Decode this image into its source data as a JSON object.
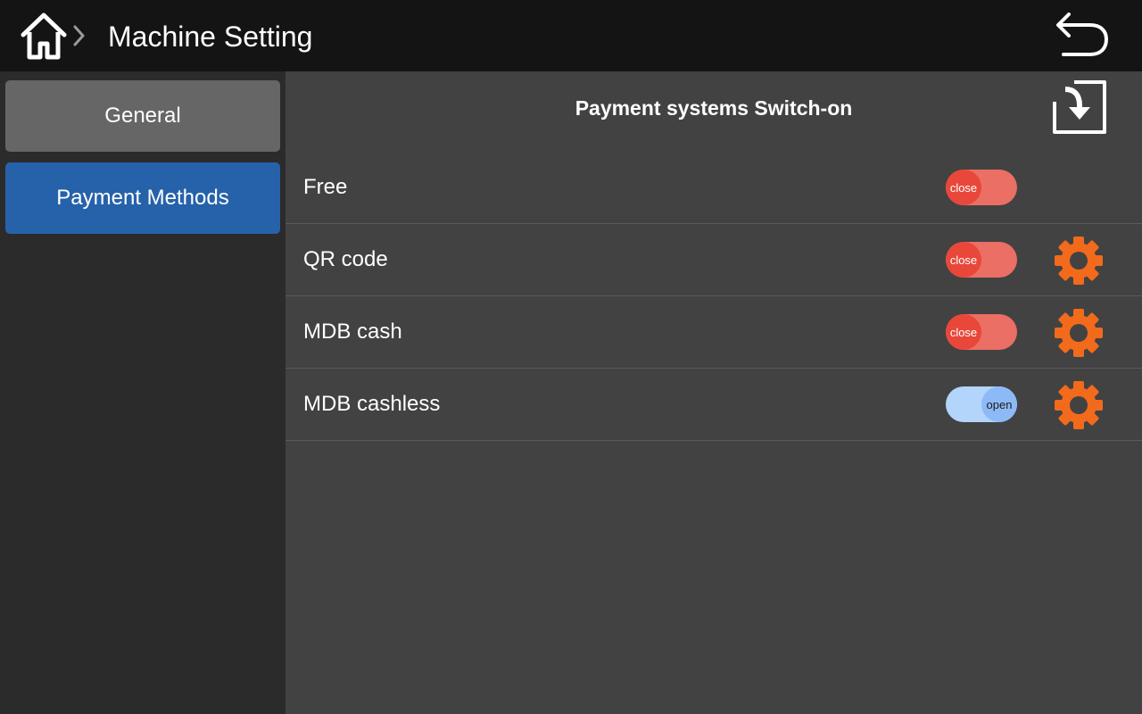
{
  "header": {
    "title": "Machine Setting",
    "home_icon": "home-icon",
    "separator_icon": "chevron-right-icon",
    "back_icon": "undo-arrow-icon"
  },
  "sidebar": {
    "items": [
      {
        "label": "General",
        "active": false
      },
      {
        "label": "Payment Methods",
        "active": true
      }
    ],
    "active_color": "#2662aa",
    "inactive_color": "#666666"
  },
  "main": {
    "section_title": "Payment systems Switch-on",
    "import_icon": "import-arrow-icon",
    "rows": [
      {
        "label": "Free",
        "state": "close",
        "has_settings": false
      },
      {
        "label": "QR code",
        "state": "close",
        "has_settings": true
      },
      {
        "label": "MDB cash",
        "state": "close",
        "has_settings": true
      },
      {
        "label": "MDB cashless",
        "state": "open",
        "has_settings": true
      }
    ],
    "settings_icon": "gear-icon",
    "settings_color": "#f26a1b"
  }
}
